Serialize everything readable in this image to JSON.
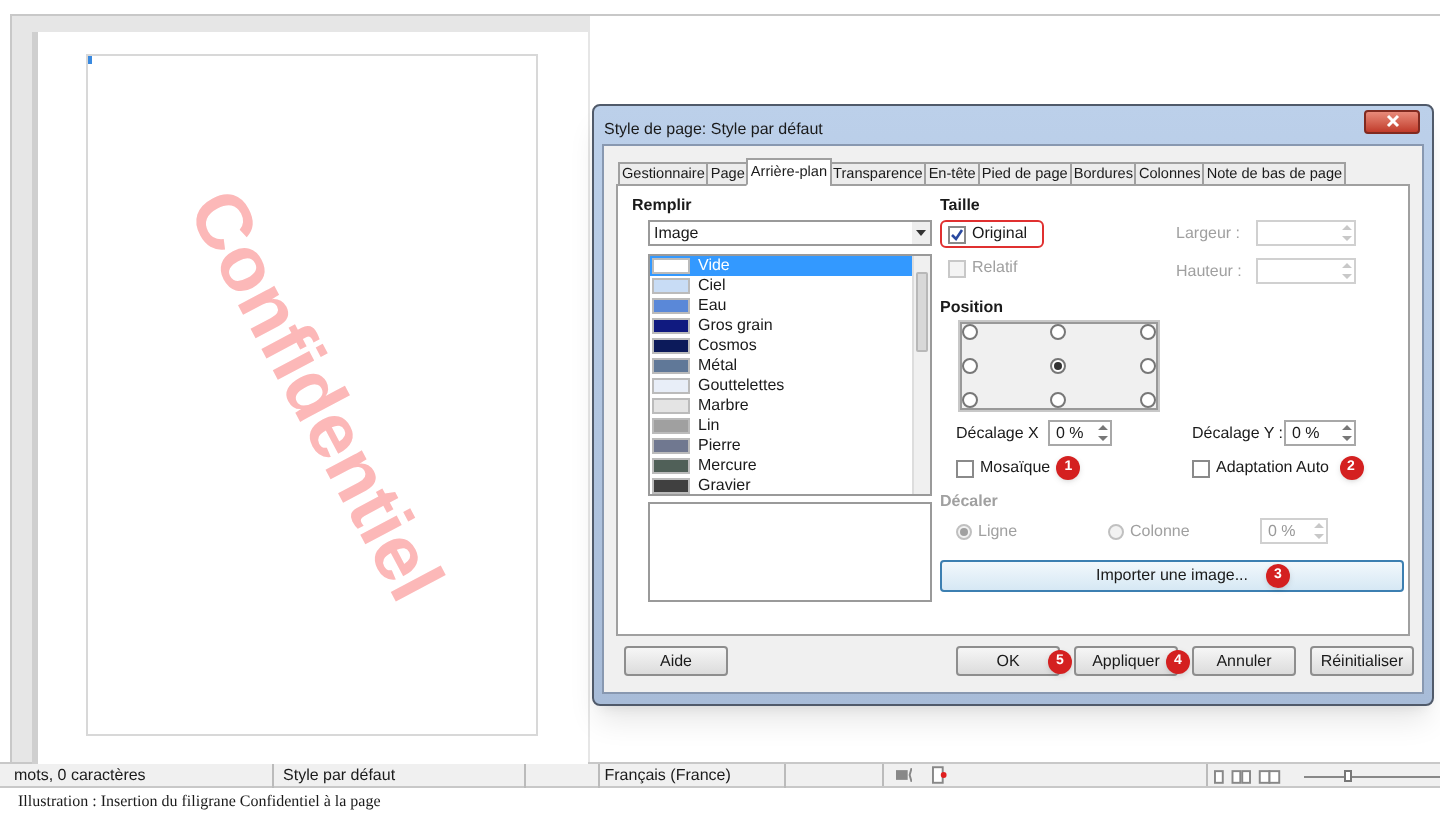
{
  "document": {
    "watermark": "Confidentiel"
  },
  "status_bar": {
    "word_count": "mots, 0 caractères",
    "page_style": "Style par défaut",
    "language": "Français (France)",
    "zoom": {
      "level": 0.3
    }
  },
  "caption": "Illustration : Insertion du filigrane Confidentiel à la page",
  "dialog": {
    "title": "Style de page: Style par défaut",
    "tabs": [
      {
        "label": "Gestionnaire",
        "selected": false
      },
      {
        "label": "Page",
        "selected": false
      },
      {
        "label": "Arrière-plan",
        "selected": true
      },
      {
        "label": "Transparence",
        "selected": false
      },
      {
        "label": "En-tête",
        "selected": false
      },
      {
        "label": "Pied de page",
        "selected": false
      },
      {
        "label": "Bordures",
        "selected": false
      },
      {
        "label": "Colonnes",
        "selected": false
      },
      {
        "label": "Note de bas de page",
        "selected": false
      }
    ],
    "fill": {
      "heading": "Remplir",
      "type": "Image",
      "items": [
        {
          "label": "Vide",
          "color": "#ffffff",
          "selected": true
        },
        {
          "label": "Ciel",
          "color": "#c8dcf5",
          "selected": false
        },
        {
          "label": "Eau",
          "color": "#5a88d8",
          "selected": false
        },
        {
          "label": "Gros grain",
          "color": "#101a80",
          "selected": false
        },
        {
          "label": "Cosmos",
          "color": "#0c1a5a",
          "selected": false
        },
        {
          "label": "Métal",
          "color": "#607898",
          "selected": false
        },
        {
          "label": "Gouttelettes",
          "color": "#e8eef8",
          "selected": false
        },
        {
          "label": "Marbre",
          "color": "#e4e4e4",
          "selected": false
        },
        {
          "label": "Lin",
          "color": "#a0a0a0",
          "selected": false
        },
        {
          "label": "Pierre",
          "color": "#707890",
          "selected": false
        },
        {
          "label": "Mercure",
          "color": "#506058",
          "selected": false
        },
        {
          "label": "Gravier",
          "color": "#404040",
          "selected": false
        }
      ]
    },
    "size": {
      "heading": "Taille",
      "original": {
        "label": "Original",
        "checked": true,
        "highlighted": true
      },
      "relative": {
        "label": "Relatif",
        "checked": false,
        "disabled": true
      },
      "width_label": "Largeur :",
      "height_label": "Hauteur :"
    },
    "position": {
      "heading": "Position",
      "anchors": [
        {
          "selected": false
        },
        {
          "selected": false
        },
        {
          "selected": false
        },
        {
          "selected": false
        },
        {
          "selected": true
        },
        {
          "selected": false
        },
        {
          "selected": false
        },
        {
          "selected": false
        },
        {
          "selected": false
        }
      ],
      "offset_x": {
        "label": "Décalage X",
        "value": "0 %"
      },
      "offset_y": {
        "label": "Décalage Y :",
        "value": "0 %"
      },
      "tile": {
        "label": "Mosaïque",
        "checked": false,
        "callout": "1"
      },
      "auto_fit": {
        "label": "Adaptation Auto",
        "checked": false,
        "callout": "2"
      }
    },
    "shift": {
      "heading": "Décaler",
      "disabled": true,
      "options": [
        {
          "label": "Ligne",
          "selected": true
        },
        {
          "label": "Colonne",
          "selected": false
        }
      ],
      "value": "0 %"
    },
    "import_button": {
      "label": "Importer une image...",
      "callout": "3"
    },
    "buttons": [
      {
        "label": "Aide"
      },
      {
        "label": "OK",
        "callout": "5"
      },
      {
        "label": "Appliquer",
        "callout": "4"
      },
      {
        "label": "Annuler"
      },
      {
        "label": "Réinitialiser"
      }
    ]
  }
}
